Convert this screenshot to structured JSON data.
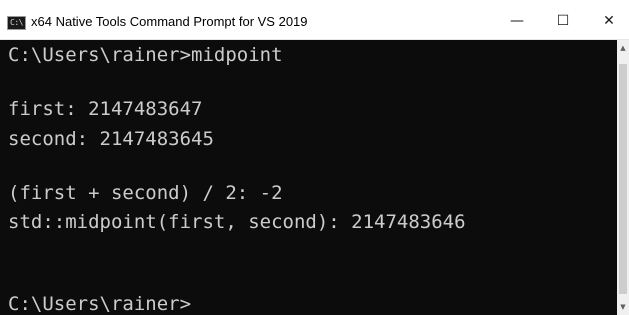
{
  "window": {
    "title": "x64 Native Tools Command Prompt for VS 2019",
    "icon": "console-app-icon",
    "icon_text": "C:\\",
    "controls": {
      "minimize": "—",
      "maximize": "☐",
      "close": "✕"
    }
  },
  "console": {
    "lines": [
      "C:\\Users\\rainer>midpoint",
      "",
      "first: 2147483647",
      "second: 2147483645",
      "",
      "(first + second) / 2: -2",
      "std::midpoint(first, second): 2147483646",
      "",
      "",
      "C:\\Users\\rainer>"
    ]
  },
  "scrollbar": {
    "up_arrow": "▲",
    "down_arrow": "▼"
  },
  "colors": {
    "console_background": "#0c0c0c",
    "console_text": "#cccccc",
    "titlebar_background": "#ffffff"
  }
}
